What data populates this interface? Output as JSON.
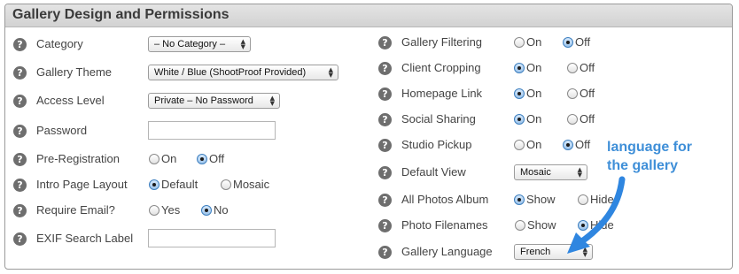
{
  "panel": {
    "title": "Gallery Design and Permissions"
  },
  "left": {
    "category": {
      "label": "Category",
      "value": "– No Category –"
    },
    "gallery_theme": {
      "label": "Gallery Theme",
      "value": "White / Blue (ShootProof Provided)"
    },
    "access_level": {
      "label": "Access Level",
      "value": "Private – No Password"
    },
    "password": {
      "label": "Password",
      "value": ""
    },
    "pre_registration": {
      "label": "Pre-Registration",
      "options": [
        "On",
        "Off"
      ],
      "selected": "Off"
    },
    "intro_page_layout": {
      "label": "Intro Page Layout",
      "options": [
        "Default",
        "Mosaic"
      ],
      "selected": "Default"
    },
    "require_email": {
      "label": "Require Email?",
      "options": [
        "Yes",
        "No"
      ],
      "selected": "No"
    },
    "exif_search_label": {
      "label": "EXIF Search Label",
      "value": ""
    }
  },
  "right": {
    "gallery_filtering": {
      "label": "Gallery Filtering",
      "options": [
        "On",
        "Off"
      ],
      "selected": "Off"
    },
    "client_cropping": {
      "label": "Client Cropping",
      "options": [
        "On",
        "Off"
      ],
      "selected": "On"
    },
    "homepage_link": {
      "label": "Homepage Link",
      "options": [
        "On",
        "Off"
      ],
      "selected": "On"
    },
    "social_sharing": {
      "label": "Social Sharing",
      "options": [
        "On",
        "Off"
      ],
      "selected": "On"
    },
    "studio_pickup": {
      "label": "Studio Pickup",
      "options": [
        "On",
        "Off"
      ],
      "selected": "Off"
    },
    "default_view": {
      "label": "Default View",
      "value": "Mosaic"
    },
    "all_photos_album": {
      "label": "All Photos Album",
      "options": [
        "Show",
        "Hide"
      ],
      "selected": "Show"
    },
    "photo_filenames": {
      "label": "Photo Filenames",
      "options": [
        "Show",
        "Hide"
      ],
      "selected": "Hide"
    },
    "gallery_language": {
      "label": "Gallery Language",
      "value": "French"
    }
  },
  "annotation": {
    "line1": "language for",
    "line2": "the gallery"
  },
  "colors": {
    "annotation": "#3f8fd8",
    "arrow": "#2f86e0",
    "help_icon": "#6e6e6e"
  },
  "icons": {
    "help": "question-mark-icon",
    "select": "up-down-arrows-icon"
  }
}
